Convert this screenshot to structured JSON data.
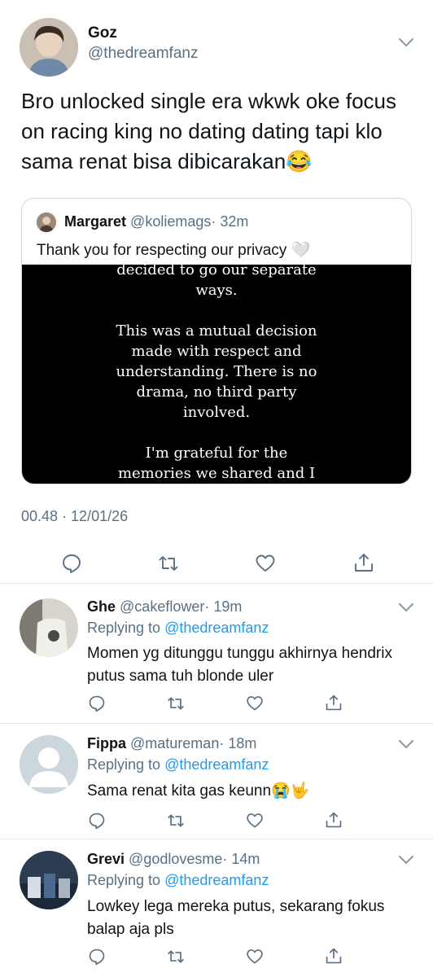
{
  "main_tweet": {
    "name": "Goz",
    "handle": "@thedreamfanz",
    "text": "Bro unlocked single era wkwk oke focus on racing king no dating dating tapi klo sama renat bisa dibicarakan😂",
    "timestamp": "00.48 · 12/01/26",
    "quote": {
      "name": "Margaret",
      "handle": "@koliemags",
      "time": "· 32m",
      "text": "Thank you for respecting our privacy 🤍",
      "media_text": "decided to go our separate\nways.\n\nThis was a mutual decision\nmade with respect and\nunderstanding. There is no\ndrama, no third party\ninvolved.\n\nI'm grateful for the\nmemories we shared and I\nwish him nothing but the"
    }
  },
  "replies": [
    {
      "name": "Ghe",
      "handle": "@cakeflower",
      "time": "· 19m",
      "replying_prefix": "Replying to",
      "replying_to": "@thedreamfanz",
      "text": "Momen yg ditunggu tunggu akhirnya hendrix putus sama tuh blonde uler"
    },
    {
      "name": "Fippa",
      "handle": "@matureman",
      "time": "· 18m",
      "replying_prefix": "Replying to",
      "replying_to": "@thedreamfanz",
      "text": "Sama renat kita gas keunn😭🤟"
    },
    {
      "name": "Grevi",
      "handle": "@godlovesme",
      "time": "· 14m",
      "replying_prefix": "Replying to",
      "replying_to": "@thedreamfanz",
      "text": "Lowkey lega mereka putus, sekarang fokus balap aja pls"
    }
  ],
  "icons": {
    "reply": "reply-icon",
    "retweet": "retweet-icon",
    "like": "heart-icon",
    "share": "share-icon",
    "menu": "chevron-down-icon"
  },
  "colors": {
    "text": "#0f1419",
    "secondary": "#5b7083",
    "link": "#1d9bf0",
    "border": "#cfd9de"
  }
}
